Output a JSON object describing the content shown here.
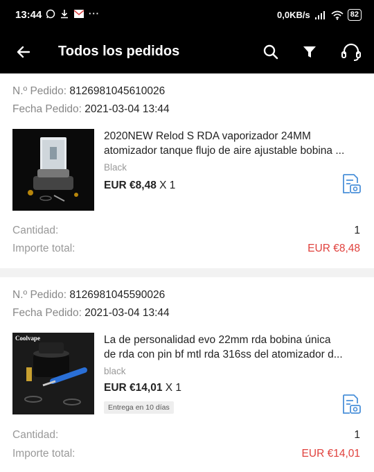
{
  "status_bar": {
    "time": "13:44",
    "network_speed": "0,0KB/s",
    "battery": "82"
  },
  "app_bar": {
    "title": "Todos los pedidos",
    "icons": [
      "back-arrow-icon",
      "search-icon",
      "filter-icon",
      "headset-icon"
    ]
  },
  "labels": {
    "order_no": "N.º Pedido:",
    "order_date": "Fecha Pedido:",
    "quantity": "Cantidad:",
    "total": "Importe total:"
  },
  "orders": [
    {
      "order_no": "8126981045610026",
      "order_date": "2021-03-04 13:44",
      "name_line1": "2020NEW Relod S RDA vaporizador 24MM",
      "name_line2": "atomizador tanque flujo de aire ajustable bobina ...",
      "variant": "Black",
      "price": "EUR €8,48",
      "qty_suffix": "X 1",
      "quantity": "1",
      "total": "EUR €8,48"
    },
    {
      "order_no": "8126981045590026",
      "order_date": "2021-03-04 13:44",
      "name_line1": "La de personalidad evo 22mm rda bobina única",
      "name_line2": "de rda con pin bf mtl rda 316ss del atomizador d...",
      "variant": "black",
      "price": "EUR €14,01",
      "qty_suffix": "X 1",
      "delivery_tag": "Entrega en 10 días",
      "brand_logo": "Coolvape",
      "quantity": "1",
      "total": "EUR €14,01"
    }
  ],
  "colors": {
    "accent_red": "#e0403c",
    "review_icon": "#4a90d9"
  }
}
